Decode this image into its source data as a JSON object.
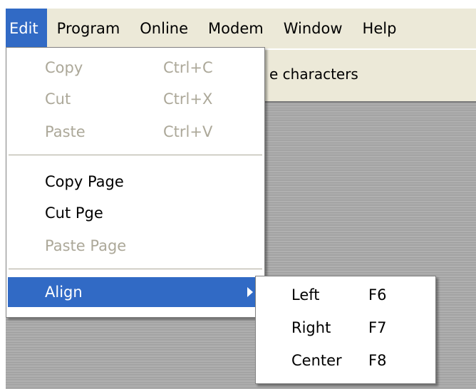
{
  "menubar": {
    "items": [
      "Edit",
      "Program",
      "Online",
      "Modem",
      "Window",
      "Help"
    ]
  },
  "background": {
    "strip_text": "e characters"
  },
  "edit_menu": {
    "copy": {
      "label": "Copy",
      "shortcut": "Ctrl+C"
    },
    "cut": {
      "label": "Cut",
      "shortcut": "Ctrl+X"
    },
    "paste": {
      "label": "Paste",
      "shortcut": "Ctrl+V"
    },
    "copy_page": {
      "label": "Copy Page"
    },
    "cut_page": {
      "label": "Cut Pge"
    },
    "paste_page": {
      "label": "Paste Page"
    },
    "align": {
      "label": "Align"
    }
  },
  "align_submenu": {
    "left": {
      "label": "Left",
      "shortcut": "F6"
    },
    "right": {
      "label": "Right",
      "shortcut": "F7"
    },
    "center": {
      "label": "Center",
      "shortcut": "F8"
    }
  },
  "colors": {
    "highlight": "#316ac5",
    "menubar_bg": "#ece9d8",
    "disabled_text": "#aca899"
  },
  "icons": {
    "submenu_arrow": "chevron-right-icon"
  }
}
